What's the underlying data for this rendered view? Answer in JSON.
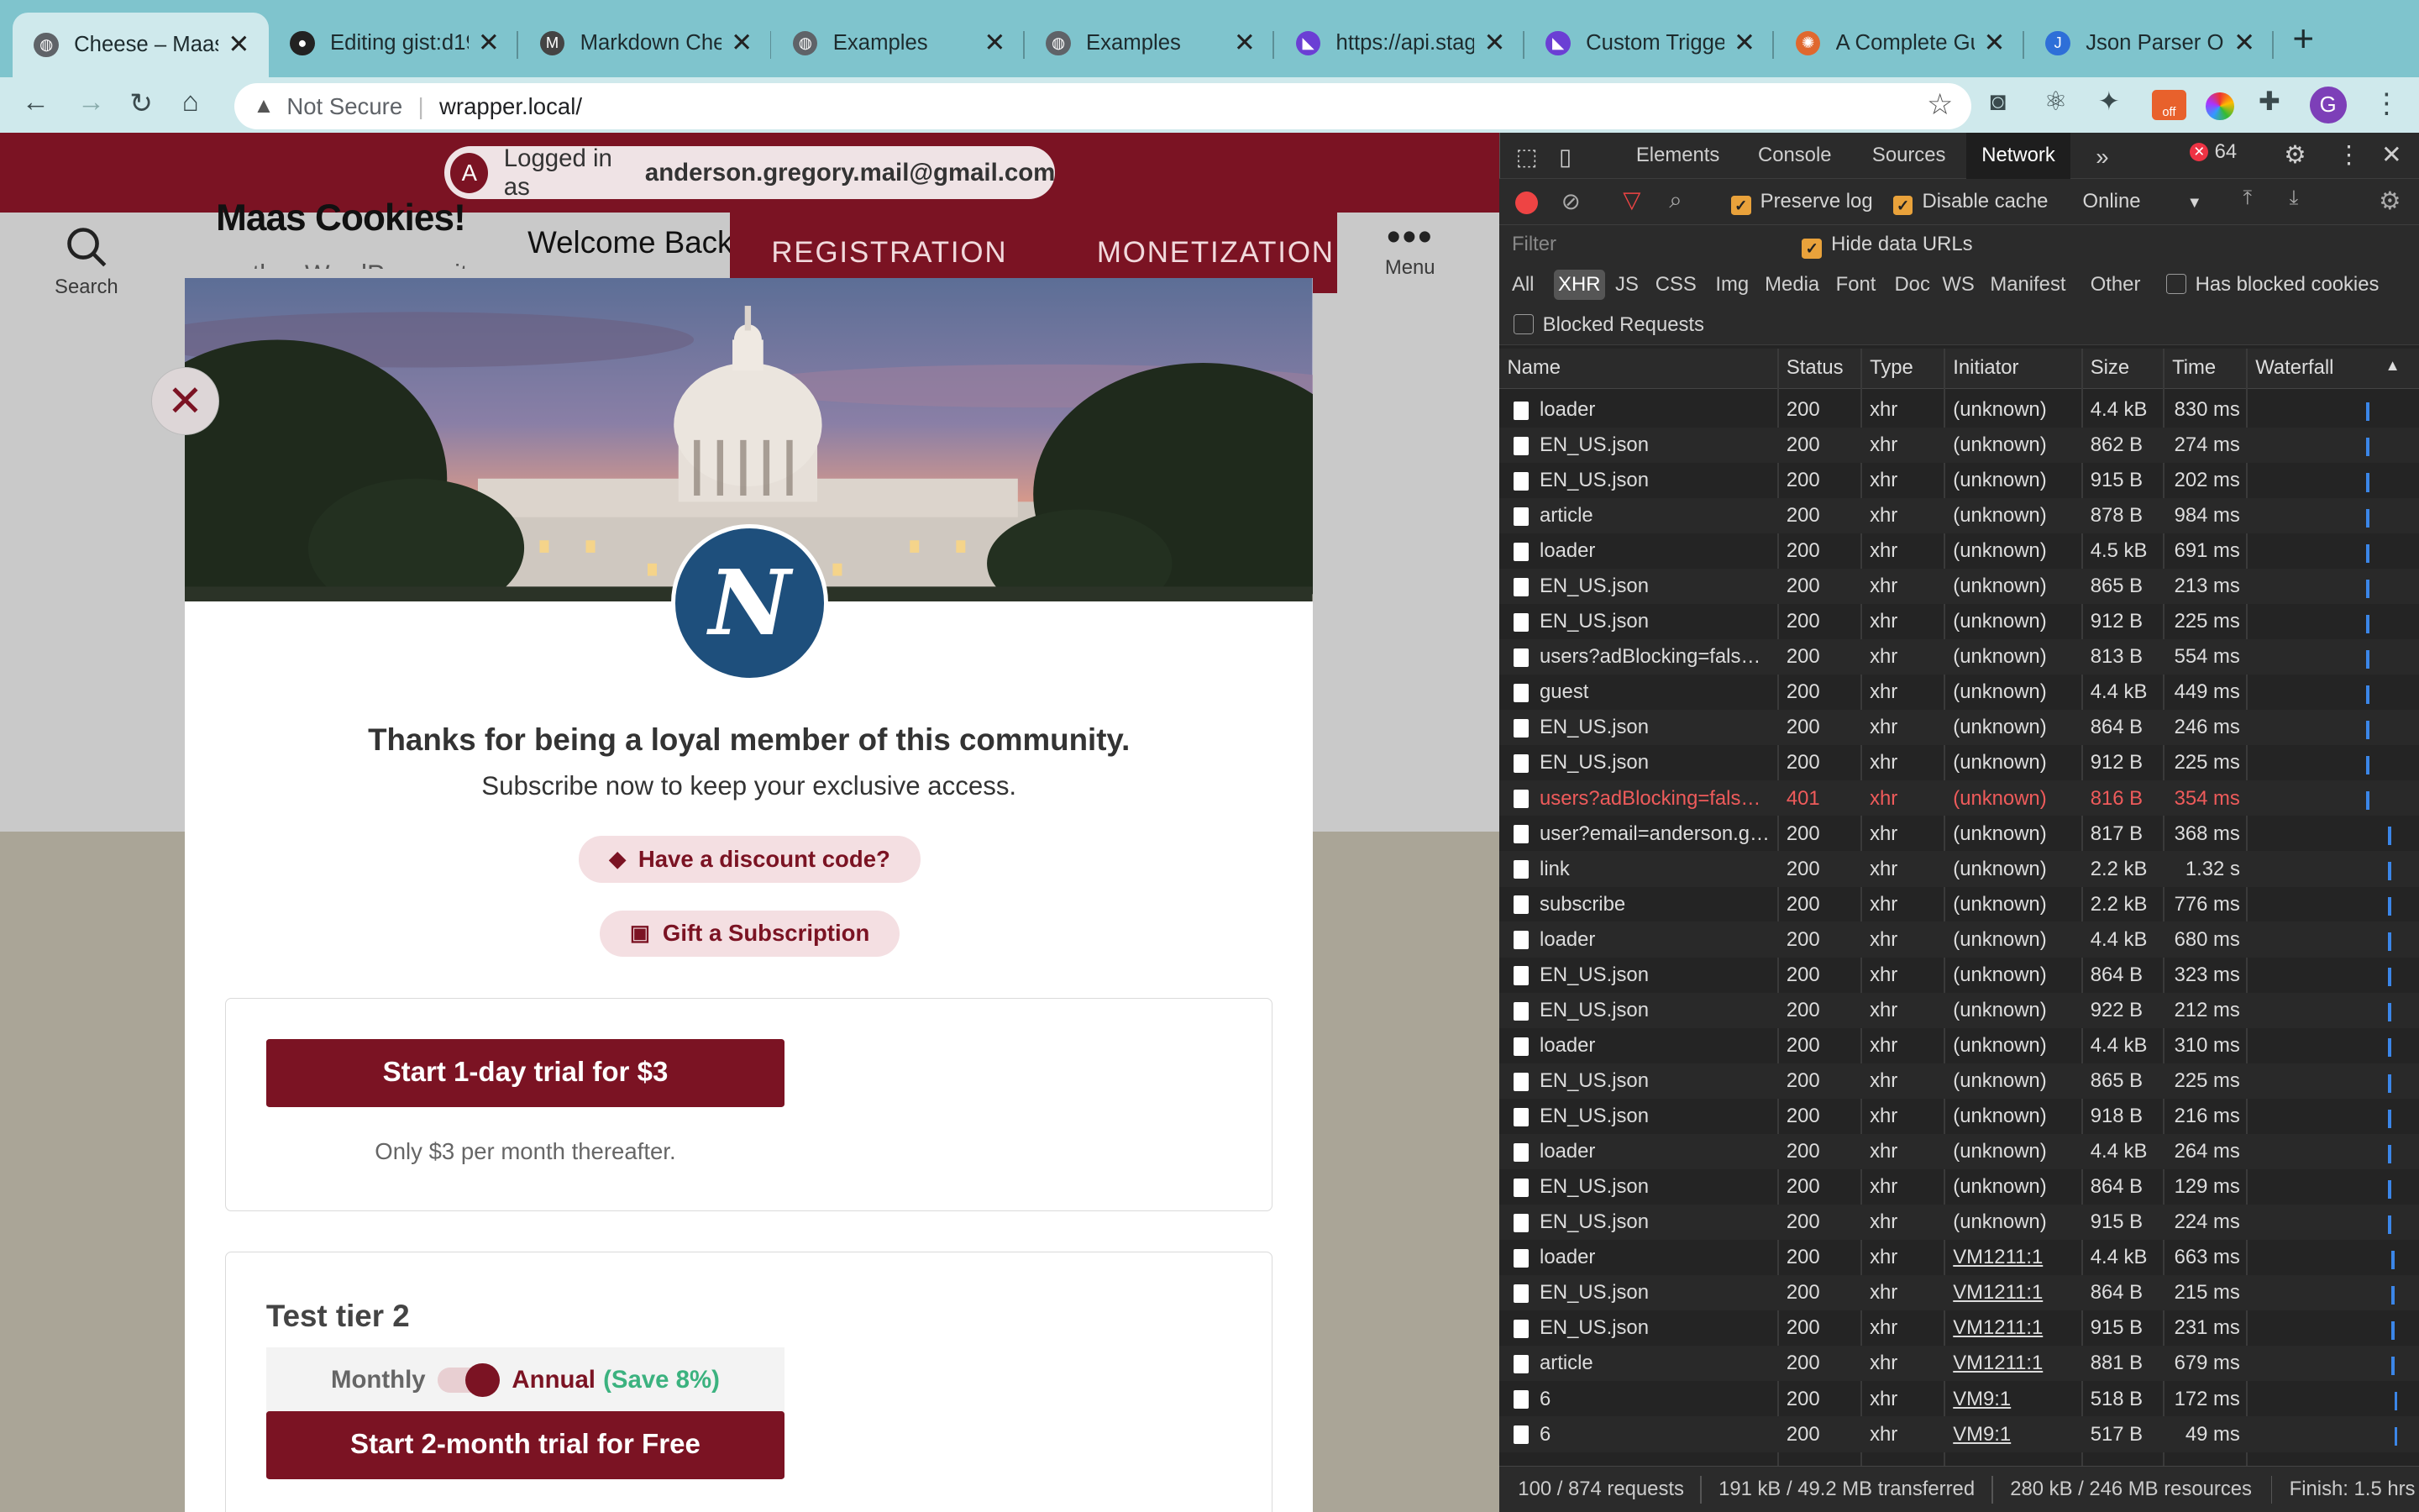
{
  "tabs": [
    {
      "title": "Cheese – Maas",
      "icon": "globe-icon",
      "active": true
    },
    {
      "title": "Editing gist:d19",
      "icon": "github-icon"
    },
    {
      "title": "Markdown Che",
      "icon": "markdown-icon"
    },
    {
      "title": "Examples",
      "icon": "globe-icon"
    },
    {
      "title": "Examples",
      "icon": "globe-icon"
    },
    {
      "title": "https://api.stag",
      "icon": "api-icon"
    },
    {
      "title": "Custom Trigge",
      "icon": "api-icon"
    },
    {
      "title": "A Complete Gu",
      "icon": "colorful-icon"
    },
    {
      "title": "Json Parser On",
      "icon": "json-icon"
    }
  ],
  "omnibox": {
    "security": "Not Secure",
    "url": "wrapper.local/"
  },
  "extension_badge": "off",
  "profile_initial": "G",
  "site": {
    "logged_in_prefix": "Logged in as",
    "logged_in_email": "anderson.gregory.mail@gmail.com",
    "avatar_initial": "A",
    "title": "Maas Cookies!",
    "tagline": "...other WordPress site",
    "welcome": "Welcome Back!",
    "nav": [
      "REGISTRATION",
      "MONETIZATION"
    ],
    "search_label": "Search",
    "menu_label": "Menu"
  },
  "modal": {
    "heading": "Thanks for being a loyal member of this community.",
    "subheading": "Subscribe now to keep your exclusive access.",
    "discount_label": "Have a discount code?",
    "gift_label": "Gift a Subscription",
    "tier1": {
      "cta": "Start 1-day trial for $3",
      "note": "Only $3 per month thereafter."
    },
    "tier2": {
      "name": "Test tier 2",
      "monthly": "Monthly",
      "annual": "Annual",
      "save": "(Save 8%)",
      "cta": "Start 2-month trial for Free"
    }
  },
  "devtools": {
    "tabs": [
      "Elements",
      "Console",
      "Sources",
      "Network"
    ],
    "active_tab": "Network",
    "error_count": "64",
    "preserve_log": "Preserve log",
    "disable_cache": "Disable cache",
    "throttle": "Online",
    "filter_placeholder": "Filter",
    "hide_data_urls": "Hide data URLs",
    "types": [
      "All",
      "XHR",
      "JS",
      "CSS",
      "Img",
      "Media",
      "Font",
      "Doc",
      "WS",
      "Manifest",
      "Other"
    ],
    "has_blocked_cookies": "Has blocked cookies",
    "blocked_requests": "Blocked Requests",
    "columns": [
      "Name",
      "Status",
      "Type",
      "Initiator",
      "Size",
      "Time",
      "Waterfall"
    ],
    "requests": [
      {
        "name": "loader",
        "status": "200",
        "type": "xhr",
        "initiator": "(unknown)",
        "size": "4.4 kB",
        "time": "830 ms"
      },
      {
        "name": "EN_US.json",
        "status": "200",
        "type": "xhr",
        "initiator": "(unknown)",
        "size": "862 B",
        "time": "274 ms"
      },
      {
        "name": "EN_US.json",
        "status": "200",
        "type": "xhr",
        "initiator": "(unknown)",
        "size": "915 B",
        "time": "202 ms"
      },
      {
        "name": "article",
        "status": "200",
        "type": "xhr",
        "initiator": "(unknown)",
        "size": "878 B",
        "time": "984 ms"
      },
      {
        "name": "loader",
        "status": "200",
        "type": "xhr",
        "initiator": "(unknown)",
        "size": "4.5 kB",
        "time": "691 ms"
      },
      {
        "name": "EN_US.json",
        "status": "200",
        "type": "xhr",
        "initiator": "(unknown)",
        "size": "865 B",
        "time": "213 ms"
      },
      {
        "name": "EN_US.json",
        "status": "200",
        "type": "xhr",
        "initiator": "(unknown)",
        "size": "912 B",
        "time": "225 ms"
      },
      {
        "name": "users?adBlocking=fals…",
        "status": "200",
        "type": "xhr",
        "initiator": "(unknown)",
        "size": "813 B",
        "time": "554 ms"
      },
      {
        "name": "guest",
        "status": "200",
        "type": "xhr",
        "initiator": "(unknown)",
        "size": "4.4 kB",
        "time": "449 ms"
      },
      {
        "name": "EN_US.json",
        "status": "200",
        "type": "xhr",
        "initiator": "(unknown)",
        "size": "864 B",
        "time": "246 ms"
      },
      {
        "name": "EN_US.json",
        "status": "200",
        "type": "xhr",
        "initiator": "(unknown)",
        "size": "912 B",
        "time": "225 ms"
      },
      {
        "name": "users?adBlocking=fals…",
        "status": "401",
        "type": "xhr",
        "initiator": "(unknown)",
        "size": "816 B",
        "time": "354 ms",
        "error": true
      },
      {
        "name": "user?email=anderson.g…",
        "status": "200",
        "type": "xhr",
        "initiator": "(unknown)",
        "size": "817 B",
        "time": "368 ms"
      },
      {
        "name": "link",
        "status": "200",
        "type": "xhr",
        "initiator": "(unknown)",
        "size": "2.2 kB",
        "time": "1.32 s"
      },
      {
        "name": "subscribe",
        "status": "200",
        "type": "xhr",
        "initiator": "(unknown)",
        "size": "2.2 kB",
        "time": "776 ms"
      },
      {
        "name": "loader",
        "status": "200",
        "type": "xhr",
        "initiator": "(unknown)",
        "size": "4.4 kB",
        "time": "680 ms"
      },
      {
        "name": "EN_US.json",
        "status": "200",
        "type": "xhr",
        "initiator": "(unknown)",
        "size": "864 B",
        "time": "323 ms"
      },
      {
        "name": "EN_US.json",
        "status": "200",
        "type": "xhr",
        "initiator": "(unknown)",
        "size": "922 B",
        "time": "212 ms"
      },
      {
        "name": "loader",
        "status": "200",
        "type": "xhr",
        "initiator": "(unknown)",
        "size": "4.4 kB",
        "time": "310 ms"
      },
      {
        "name": "EN_US.json",
        "status": "200",
        "type": "xhr",
        "initiator": "(unknown)",
        "size": "865 B",
        "time": "225 ms"
      },
      {
        "name": "EN_US.json",
        "status": "200",
        "type": "xhr",
        "initiator": "(unknown)",
        "size": "918 B",
        "time": "216 ms"
      },
      {
        "name": "loader",
        "status": "200",
        "type": "xhr",
        "initiator": "(unknown)",
        "size": "4.4 kB",
        "time": "264 ms"
      },
      {
        "name": "EN_US.json",
        "status": "200",
        "type": "xhr",
        "initiator": "(unknown)",
        "size": "864 B",
        "time": "129 ms"
      },
      {
        "name": "EN_US.json",
        "status": "200",
        "type": "xhr",
        "initiator": "(unknown)",
        "size": "915 B",
        "time": "224 ms"
      },
      {
        "name": "loader",
        "status": "200",
        "type": "xhr",
        "initiator": "VM1211:1",
        "size": "4.4 kB",
        "time": "663 ms"
      },
      {
        "name": "EN_US.json",
        "status": "200",
        "type": "xhr",
        "initiator": "VM1211:1",
        "size": "864 B",
        "time": "215 ms"
      },
      {
        "name": "EN_US.json",
        "status": "200",
        "type": "xhr",
        "initiator": "VM1211:1",
        "size": "915 B",
        "time": "231 ms"
      },
      {
        "name": "article",
        "status": "200",
        "type": "xhr",
        "initiator": "VM1211:1",
        "size": "881 B",
        "time": "679 ms"
      },
      {
        "name": "6",
        "status": "200",
        "type": "xhr",
        "initiator": "VM9:1",
        "size": "518 B",
        "time": "172 ms"
      },
      {
        "name": "6",
        "status": "200",
        "type": "xhr",
        "initiator": "VM9:1",
        "size": "517 B",
        "time": "49 ms"
      }
    ],
    "statusbar": {
      "requests": "100 / 874 requests",
      "transferred": "191 kB / 49.2 MB transferred",
      "resources": "280 kB / 246 MB resources",
      "finish": "Finish: 1.5 hrs"
    }
  },
  "colors": {
    "brand": "#7b1323",
    "tabbar": "#7fc4cd",
    "error": "#ef5b5b",
    "waterfall": "#3b86e8"
  }
}
